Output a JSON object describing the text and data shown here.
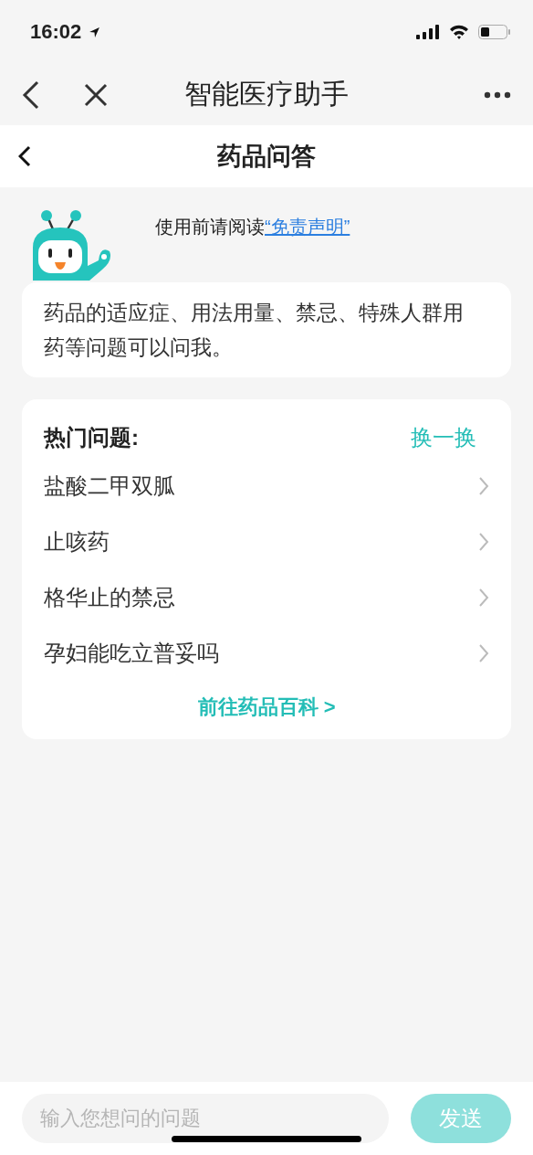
{
  "status_bar": {
    "time": "16:02"
  },
  "nav_bar": {
    "title": "智能医疗助手"
  },
  "page_header": {
    "title": "药品问答"
  },
  "disclaimer": {
    "text": "使用前请阅读",
    "link": "“免责声明”"
  },
  "intro": {
    "text": "药品的适应症、用法用量、禁忌、特殊人群用药等问题可以问我。"
  },
  "hot_questions": {
    "title": "热门问题:",
    "refresh": "换一换",
    "items": [
      {
        "label": "盐酸二甲双胍"
      },
      {
        "label": "止咳药"
      },
      {
        "label": "格华止的禁忌"
      },
      {
        "label": "孕妇能吃立普妥吗"
      }
    ],
    "more_link": "前往药品百科 >"
  },
  "composer": {
    "placeholder": "输入您想问的问题",
    "send": "发送",
    "send_disabled": true
  }
}
